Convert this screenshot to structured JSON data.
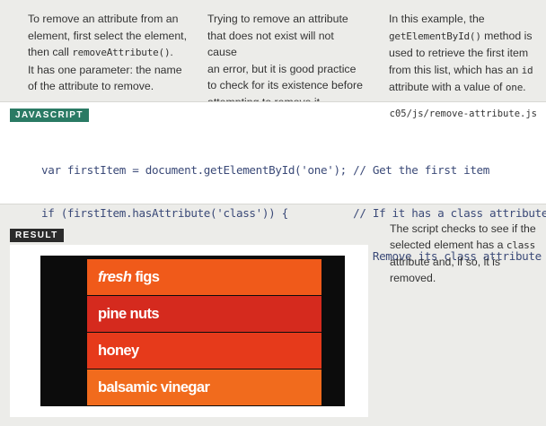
{
  "columns": [
    {
      "line1": "To remove an attribute from an",
      "line2": "element, first select the element,",
      "line3_pre": "then call ",
      "line3_code": "removeAttribute()",
      "line3_post": ".",
      "line4": "It has one parameter: the name",
      "line5": "of the attribute to remove."
    },
    {
      "line1": "Trying to remove an attribute",
      "line2": "that does not exist will not cause",
      "line3": "an error, but it is good practice",
      "line4": "to check for its existence before",
      "line5": "attempting to remove it."
    },
    {
      "line1": "In this example, the",
      "line2_code": "getElementById()",
      "line2_post": " method is",
      "line3": "used to retrieve the first item",
      "line4_pre": "from this list, which has an ",
      "line4_code": "id",
      "line5_pre": "attribute with a value of ",
      "line5_code": "one",
      "line5_post": "."
    }
  ],
  "code_panel": {
    "tag": "JAVASCRIPT",
    "filename": "c05/js/remove-attribute.js",
    "lines": [
      "var firstItem = document.getElementById('one'); // Get the first item",
      "if (firstItem.hasAttribute('class')) {          // If it has a class attribute",
      "    firstItem.removeAttribute('class');         // Remove its class attribute",
      "}"
    ]
  },
  "result": {
    "tag": "RESULT",
    "items": [
      {
        "em": "fresh",
        "rest": " figs",
        "color": "#f05a1a"
      },
      {
        "em": "",
        "rest": "pine nuts",
        "color": "#d52a1e"
      },
      {
        "em": "",
        "rest": "honey",
        "color": "#e63a1b"
      },
      {
        "em": "",
        "rest": "balsamic vinegar",
        "color": "#f16b1d"
      }
    ]
  },
  "side_note": {
    "line1": "The script checks to see if the",
    "line2": "selected element has a ",
    "line2_code": "class",
    "line3": "attribute and, if so, it is removed."
  }
}
